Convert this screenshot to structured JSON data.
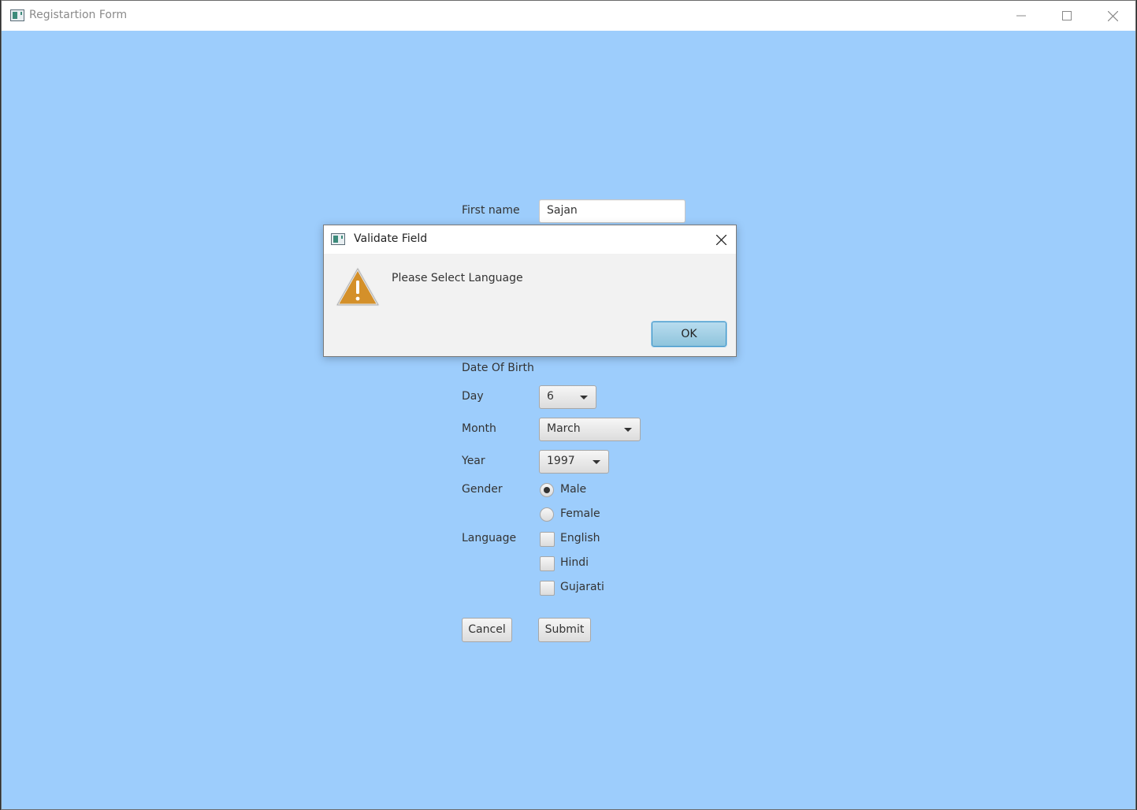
{
  "window": {
    "title": "Registartion Form"
  },
  "form": {
    "first_name_label": "First name",
    "first_name_value": "Sajan",
    "dob_label": "Date Of Birth",
    "day_label": "Day",
    "day_value": "6",
    "month_label": "Month",
    "month_value": "March",
    "year_label": "Year",
    "year_value": "1997",
    "gender_label": "Gender",
    "gender_options": [
      "Male",
      "Female"
    ],
    "gender_selected": "Male",
    "language_label": "Language",
    "language_options": [
      "English",
      "Hindi",
      "Gujarati"
    ],
    "language_checked": [],
    "cancel_label": "Cancel",
    "submit_label": "Submit"
  },
  "dialog": {
    "title": "Validate Field",
    "message": "Please Select Language",
    "ok_label": "OK"
  },
  "colors": {
    "background": "#9dcdfc",
    "warning": "#d4902a",
    "ok_button": "#a6d2ea"
  },
  "icons": {
    "app": "java-app-icon",
    "warning": "warning-triangle-icon"
  }
}
